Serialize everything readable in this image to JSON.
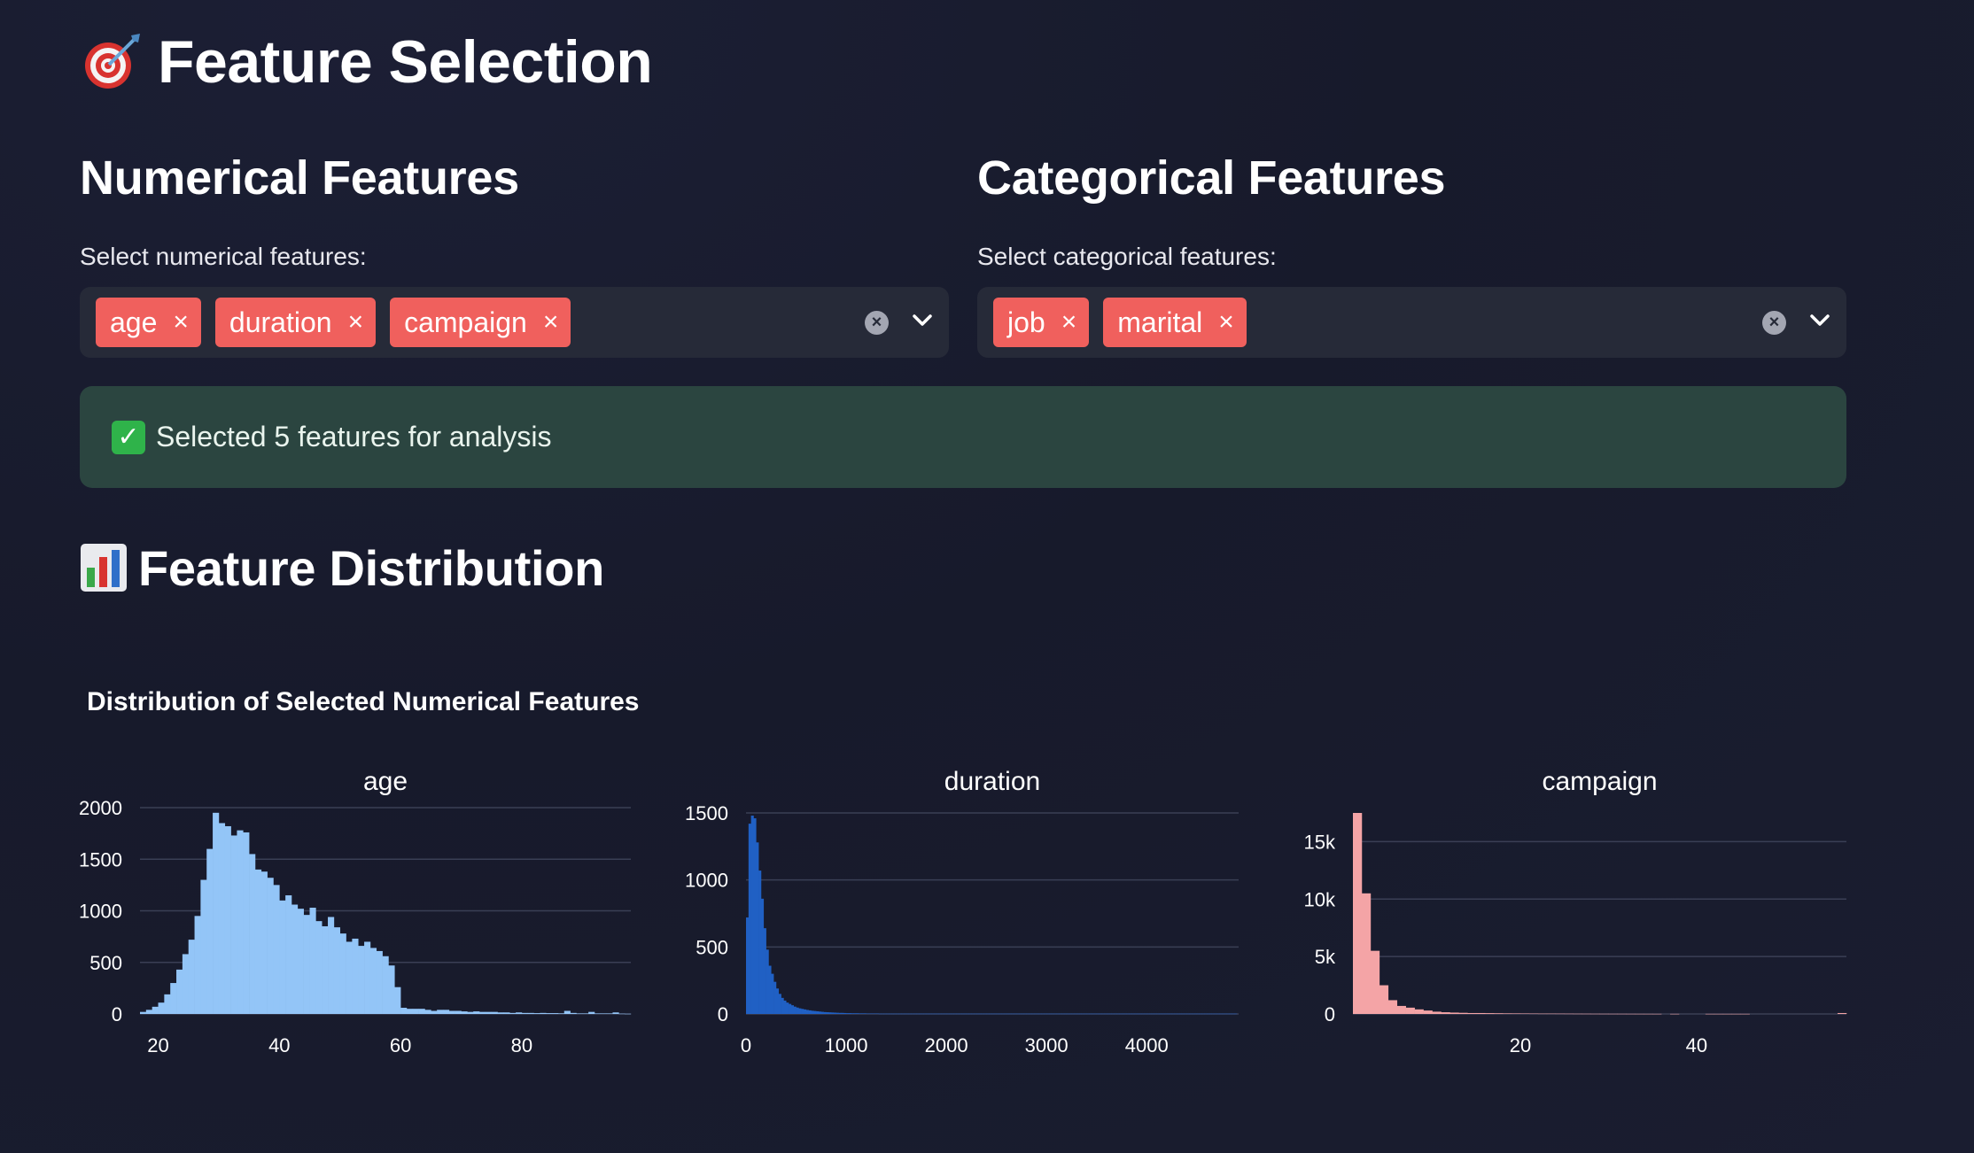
{
  "page": {
    "title": "Feature Selection",
    "title_icon": "dart-target-icon"
  },
  "numerical": {
    "heading": "Numerical Features",
    "label": "Select numerical features:",
    "chips": [
      "age",
      "duration",
      "campaign"
    ]
  },
  "categorical": {
    "heading": "Categorical Features",
    "label": "Select categorical features:",
    "chips": [
      "job",
      "marital"
    ]
  },
  "success": {
    "icon": "check-mark-icon",
    "text": "Selected 5 features for analysis"
  },
  "distribution": {
    "heading": "Feature Distribution",
    "icon": "bar-chart-icon"
  },
  "colors": {
    "chip": "#f0605d",
    "age": "#93c5f7",
    "duration": "#2060c4",
    "campaign": "#f4a4a6",
    "gridline": "#3a3f55"
  },
  "chart_data": [
    {
      "type": "bar",
      "title": "Distribution of Selected Numerical Features",
      "subtitle": "age",
      "xlim": [
        17,
        98
      ],
      "ylim": [
        0,
        2000
      ],
      "xticks": [
        20,
        40,
        60,
        80
      ],
      "yticks": [
        0,
        500,
        1000,
        1500,
        2000
      ],
      "ytick_labels": [
        "0",
        "500",
        "1000",
        "1500",
        "2000"
      ],
      "bin_start": 17,
      "bin_width": 1,
      "values": [
        20,
        40,
        70,
        110,
        190,
        300,
        430,
        580,
        720,
        950,
        1300,
        1600,
        1950,
        1850,
        1820,
        1730,
        1780,
        1760,
        1550,
        1400,
        1380,
        1320,
        1250,
        1100,
        1150,
        1060,
        1020,
        960,
        1030,
        900,
        850,
        940,
        840,
        780,
        700,
        730,
        660,
        700,
        640,
        610,
        560,
        470,
        260,
        60,
        50,
        50,
        50,
        40,
        30,
        40,
        40,
        30,
        30,
        25,
        20,
        25,
        20,
        20,
        20,
        15,
        15,
        10,
        15,
        10,
        10,
        8,
        10,
        8,
        8,
        6,
        30,
        10,
        5,
        5,
        20,
        5,
        5,
        5,
        15,
        3,
        2
      ]
    },
    {
      "type": "bar",
      "subtitle": "duration",
      "xlim": [
        0,
        4918
      ],
      "ylim": [
        0,
        1500
      ],
      "xticks": [
        0,
        1000,
        2000,
        3000,
        4000
      ],
      "yticks": [
        0,
        500,
        1000,
        1500
      ],
      "ytick_labels": [
        "0",
        "500",
        "1000",
        "1500"
      ],
      "bin_start": 0,
      "bin_width": 25,
      "values": [
        720,
        1420,
        1480,
        1460,
        1280,
        1070,
        860,
        640,
        480,
        360,
        300,
        240,
        190,
        150,
        120,
        100,
        85,
        75,
        65,
        55,
        48,
        42,
        38,
        34,
        30,
        27,
        24,
        22,
        20,
        18,
        16,
        14,
        13,
        12,
        11,
        10,
        9,
        8,
        8,
        7,
        6,
        6,
        5,
        5,
        5,
        4,
        4,
        4,
        3,
        3,
        3,
        3,
        3,
        2,
        2,
        2,
        2,
        2,
        2,
        2,
        2,
        2,
        2,
        2,
        2,
        2,
        2,
        2,
        2,
        2,
        2,
        2,
        2,
        2,
        2,
        2,
        2,
        2,
        2,
        2,
        2,
        2,
        2,
        2,
        2,
        2,
        2,
        2,
        2,
        2,
        2,
        2,
        2,
        2,
        2,
        2,
        2,
        2,
        2,
        2,
        2,
        2,
        2,
        2,
        2,
        2,
        2,
        2,
        2,
        2,
        2,
        2,
        2,
        2,
        2,
        2,
        2,
        2,
        2,
        2,
        2,
        2,
        2,
        2,
        2,
        2,
        2,
        2,
        2,
        2,
        2,
        2,
        2,
        2,
        2,
        2,
        2,
        2,
        2,
        2,
        2,
        2,
        2,
        2,
        2,
        2,
        2,
        2,
        2,
        2,
        2,
        2,
        2,
        2,
        2,
        2,
        2,
        2,
        2,
        2,
        2,
        2,
        2,
        2,
        2,
        2,
        2,
        2,
        2,
        2,
        2,
        2,
        2,
        2,
        2,
        2,
        2,
        2,
        2,
        2,
        2,
        2,
        2,
        2,
        2,
        2,
        2,
        2,
        2,
        2,
        2,
        2,
        2,
        2,
        2,
        2
      ]
    },
    {
      "type": "bar",
      "subtitle": "campaign",
      "xlim": [
        1,
        57
      ],
      "ylim": [
        0,
        17500
      ],
      "xticks": [
        20,
        40
      ],
      "yticks": [
        0,
        5000,
        10000,
        15000
      ],
      "ytick_labels": [
        "0",
        "5k",
        "10k",
        "15k"
      ],
      "bin_start": 1,
      "bin_width": 1,
      "values": [
        17500,
        10500,
        5500,
        2500,
        1200,
        700,
        550,
        400,
        300,
        200,
        150,
        120,
        100,
        80,
        80,
        70,
        60,
        50,
        45,
        40,
        35,
        30,
        30,
        28,
        25,
        22,
        20,
        18,
        17,
        16,
        15,
        14,
        13,
        12,
        11,
        0,
        10,
        0,
        0,
        0,
        10,
        10,
        10,
        10,
        10,
        0,
        0,
        0,
        0,
        0,
        0,
        0,
        0,
        0,
        0,
        80
      ]
    }
  ]
}
